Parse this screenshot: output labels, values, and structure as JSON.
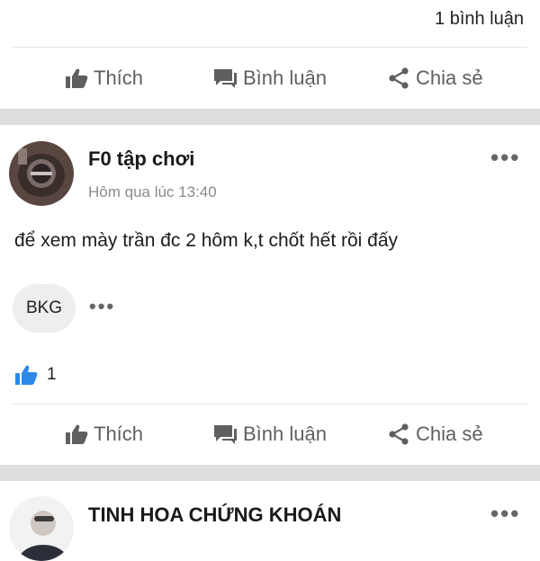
{
  "top": {
    "comments_count": "1 bình luận"
  },
  "actions": {
    "like": "Thích",
    "comment": "Bình luận",
    "share": "Chia sẻ"
  },
  "post": {
    "author": "F0 tập chơi",
    "time": "Hôm qua lúc 13:40",
    "content": "để xem mày trần đc 2 hôm k,t chốt hết rồi đấy",
    "tag": "BKG",
    "tag_more": "•••",
    "more": "•••",
    "like_count": "1"
  },
  "next_post": {
    "author": "TINH HOA CHỨNG KHOÁN",
    "more": "•••"
  },
  "colors": {
    "divider": "#dedede",
    "like_blue": "#2d88e6",
    "action_gray": "#5f5f5f"
  }
}
